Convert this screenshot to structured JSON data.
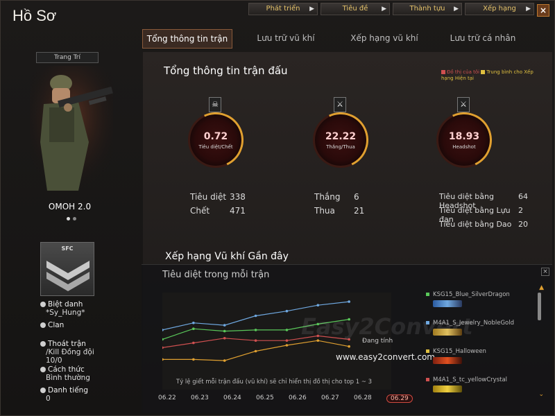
{
  "header": {
    "title": "Hồ Sơ",
    "top_buttons": [
      "Phát triển",
      "Tiêu đề",
      "Thành tựu",
      "Xếp hạng"
    ],
    "close": "×"
  },
  "tabs": [
    "Tổng thông tin trận đấu",
    "Lưu trữ vũ khí",
    "Xếp hạng vũ khí",
    "Lưu trữ cá nhân"
  ],
  "left": {
    "decorate_label": "Trang Trí",
    "player_name": "OMOH 2.0",
    "rank_code": "SFC",
    "nickname_label": "Biệt danh",
    "nickname": "*Sy_Hung*",
    "clan_label": "Clan",
    "escape_label": "Thoát trận",
    "escape_sub": "/Kill Đồng đội",
    "escape_value": "10/0",
    "method_label": "Cách thức",
    "method_value": "Bình thường",
    "fame_label": "Danh tiếng",
    "fame_value": "0"
  },
  "main": {
    "title": "Tổng thông tin trận đấu",
    "legend_mine": "Đồ thị của tôi",
    "legend_avg": "Trung bình cho Xếp hạng Hiện tại",
    "circles": [
      {
        "value": "0.72",
        "label": "Tiêu diệt/Chết",
        "icon": "skull-icon",
        "glyph": "☠"
      },
      {
        "value": "22.22",
        "label": "Thắng/Thua",
        "icon": "crossed-swords-icon",
        "glyph": "⚔"
      },
      {
        "value": "18.93",
        "label": "Headshot",
        "icon": "knife-icon",
        "glyph": "⚔"
      }
    ],
    "stats": {
      "kills_label": "Tiêu diệt",
      "kills": "338",
      "deaths_label": "Chết",
      "deaths": "471",
      "wins_label": "Thắng",
      "wins": "6",
      "losses_label": "Thua",
      "losses": "21",
      "hs_label": "Tiêu diệt bằng Headshot",
      "hs": "64",
      "grenade_label": "Tiêu diệt bằng Lựu đạn",
      "grenade": "2",
      "knife_label": "Tiêu diệt bằng Dao",
      "knife": "20"
    },
    "ranking_title": "Xếp hạng Vũ khí Gần đây"
  },
  "chart_panel": {
    "title": "Tiêu diệt trong mỗi trận",
    "status": "Đang tính",
    "note": "Tỷ lệ giết mỗi trận đấu (vũ khí) sẽ chỉ hiển thị đồ thị cho top 1 ~ 3",
    "watermark": "Easy2Convert",
    "watermark_url": "www.easy2convert.com",
    "close": "×"
  },
  "chart_data": {
    "type": "line",
    "title": "Tiêu diệt trong mỗi trận",
    "x": [
      "06.22",
      "06.23",
      "06.24",
      "06.25",
      "06.26",
      "06.27",
      "06.28",
      "06.29"
    ],
    "selected_x": "06.29",
    "series": [
      {
        "name": "KSG15_Blue_SilverDragon",
        "color": "#6fa8e0",
        "values": [
          3.3,
          3.9,
          3.7,
          4.5,
          4.9,
          5.4,
          5.7
        ]
      },
      {
        "name": "M4A1_S_Jewelry_NobleGold",
        "color": "#5ac85a",
        "values": [
          2.5,
          3.4,
          3.2,
          3.3,
          3.3,
          3.8,
          4.2
        ]
      },
      {
        "name": "KSG15_Halloween",
        "color": "#d05050",
        "values": [
          1.8,
          2.2,
          2.6,
          2.4,
          2.4,
          2.8,
          2.5
        ]
      },
      {
        "name": "M4A1_S_tc_yellowCrystal",
        "color": "#e0a030",
        "values": [
          0.8,
          0.8,
          0.7,
          1.5,
          2.0,
          2.4,
          1.9
        ]
      }
    ]
  },
  "colors": {
    "accent": "#e0a030",
    "active_tab_border": "#8a5a3a",
    "mine": "#d05050",
    "avg": "#e0c040"
  }
}
